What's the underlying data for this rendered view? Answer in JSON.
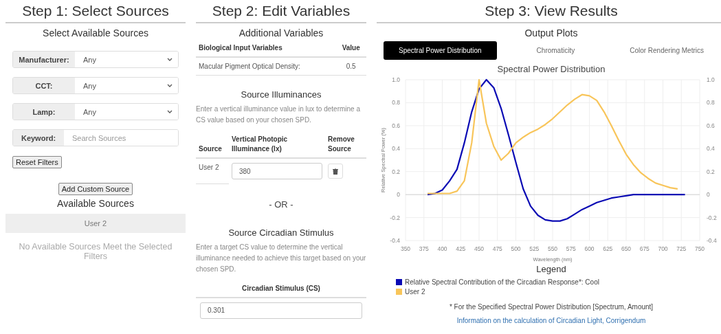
{
  "step1": {
    "title": "Step 1: Select Sources",
    "subtitle": "Select Available Sources",
    "filters": [
      {
        "kind": "select",
        "label": "Manufacturer:",
        "value": "Any"
      },
      {
        "kind": "select",
        "label": "CCT:",
        "value": "Any"
      },
      {
        "kind": "select",
        "label": "Lamp:",
        "value": "Any"
      },
      {
        "kind": "text",
        "label": "Keyword:",
        "placeholder": "Search Sources"
      }
    ],
    "reset_button": "Reset Filters",
    "add_button": "Add Custom Source",
    "available_title": "Available Sources",
    "sources": [
      {
        "name": "User 2"
      }
    ],
    "empty_message": "No Available Sources Meet the Selected Filters"
  },
  "step2": {
    "title": "Step 2: Edit Variables",
    "subtitle": "Additional Variables",
    "variables_table": {
      "columns": [
        "Biological Input Variables",
        "Value"
      ],
      "rows": [
        [
          "Macular Pigment Optical Density:",
          "0.5"
        ]
      ]
    },
    "illuminance_title": "Source Illuminances",
    "illuminance_text": "Enter a vertical illuminance value in lux to determine a CS value based on your chosen SPD.",
    "illuminance_table": {
      "columns": [
        "Source",
        "Vertical Photopic Illuminance (lx)",
        "Remove Source"
      ],
      "rows": [
        {
          "source": "User 2",
          "value": "380"
        }
      ]
    },
    "or_text": "- OR -",
    "stimulus_title": "Source Circadian Stimulus",
    "stimulus_text": "Enter a target CS value to determine the vertical illuminance needed to achieve this target based on your chosen SPD.",
    "stimulus_label": "Circadian Stimulus (CS)",
    "stimulus_value": "0.301"
  },
  "step3": {
    "title": "Step 3: View Results",
    "subtitle": "Output Plots",
    "tabs": [
      {
        "label": "Spectral Power Distribution",
        "selected": true
      },
      {
        "label": "Chromaticity",
        "selected": false
      },
      {
        "label": "Color Rendering Metrics",
        "selected": false
      }
    ],
    "chart_data": {
      "type": "line",
      "title": "Spectral Power Distribution",
      "xlabel": "Wavelength (nm)",
      "ylabel": "Relative Spectral Power (%)",
      "x": [
        380,
        390,
        400,
        410,
        420,
        430,
        440,
        450,
        460,
        470,
        480,
        490,
        500,
        510,
        520,
        530,
        540,
        550,
        560,
        570,
        580,
        590,
        600,
        610,
        620,
        630,
        640,
        650,
        660,
        670,
        680,
        690,
        700,
        710,
        720,
        730
      ],
      "series": [
        {
          "name": "Relative Spectral Contribution of the Circadian Response*: Cool",
          "color": "#0a0ab4",
          "values": [
            0,
            0.01,
            0.04,
            0.12,
            0.22,
            0.45,
            0.72,
            0.92,
            1.0,
            0.93,
            0.75,
            0.52,
            0.28,
            0.05,
            -0.1,
            -0.18,
            -0.22,
            -0.23,
            -0.23,
            -0.21,
            -0.17,
            -0.13,
            -0.1,
            -0.07,
            -0.05,
            -0.03,
            -0.02,
            -0.01,
            0,
            0,
            0,
            0,
            0,
            0,
            0,
            0
          ]
        },
        {
          "name": "User 2",
          "color": "#f8c55a",
          "values": [
            0.01,
            0.01,
            0.01,
            0.01,
            0.03,
            0.12,
            0.45,
            1.0,
            0.62,
            0.42,
            0.3,
            0.36,
            0.45,
            0.5,
            0.54,
            0.57,
            0.61,
            0.66,
            0.72,
            0.78,
            0.83,
            0.87,
            0.86,
            0.82,
            0.72,
            0.6,
            0.47,
            0.35,
            0.26,
            0.19,
            0.14,
            0.1,
            0.08,
            0.06,
            0.05,
            null
          ]
        }
      ],
      "xlim": [
        350,
        750
      ],
      "ylim": [
        -0.4,
        1.0
      ],
      "xticks": [
        350,
        375,
        400,
        425,
        450,
        475,
        500,
        525,
        550,
        575,
        600,
        625,
        650,
        675,
        700,
        725,
        750
      ],
      "yticks": [
        {
          "value": -0.4,
          "label": "-0.4"
        },
        {
          "value": -0.2,
          "label": "-0.2"
        },
        {
          "value": 0,
          "label": "0"
        },
        {
          "value": 0.2,
          "label": "0.2"
        },
        {
          "value": 0.4,
          "label": "0.4"
        },
        {
          "value": 0.6,
          "label": "0.6"
        },
        {
          "value": 0.8,
          "label": "0.8"
        },
        {
          "value": 1.0,
          "label": "1.0"
        }
      ],
      "y2ticks": [
        {
          "value": -0.4,
          "label": "-0.4"
        },
        {
          "value": -0.2,
          "label": "-0.2"
        },
        {
          "value": 0,
          "label": "0"
        },
        {
          "value": 0.2,
          "label": "0.2"
        },
        {
          "value": 0.4,
          "label": "0.4"
        },
        {
          "value": 0.6,
          "label": "0.6"
        },
        {
          "value": 0.8,
          "label": "0.8"
        },
        {
          "value": 1.0,
          "label": "1.0"
        }
      ],
      "y2lim": [
        -0.4,
        1.0
      ],
      "grid": true
    },
    "legend_title": "Legend",
    "footnote": "* For the Specified Spectral Power Distribution [Spectrum, Amount]",
    "link": "Information on the calculation of Circadian Light, Corrigendum"
  }
}
